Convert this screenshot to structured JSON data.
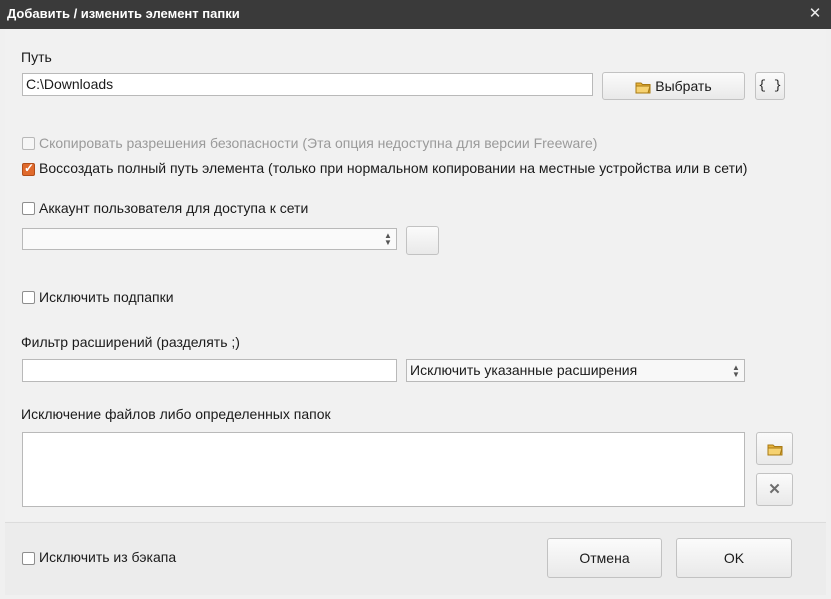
{
  "window": {
    "title": "Добавить / изменить элемент папки",
    "close_glyph": "✕"
  },
  "path": {
    "label": "Путь",
    "value": "C:\\Downloads",
    "browse_label": "Выбрать",
    "macro_label": "{ }"
  },
  "options": {
    "copy_permissions": {
      "label": "Скопировать разрешения безопасности (Эта опция недоступна для версии Freeware)",
      "checked": false,
      "disabled": true
    },
    "recreate_path": {
      "label": "Воссоздать полный путь элемента (только при нормальном копировании на местные устройства или в сети)",
      "checked": true
    },
    "network_account": {
      "label": "Аккаунт пользователя для доступа к сети",
      "checked": false
    },
    "exclude_subfolders": {
      "label": "Исключить подпапки",
      "checked": false
    }
  },
  "account": {
    "value": ""
  },
  "filter": {
    "label": "Фильтр расширений (разделять ;)",
    "value": "",
    "mode": "Исключить указанные расширения"
  },
  "exclusions": {
    "label": "Исключение файлов либо определенных папок"
  },
  "footer": {
    "exclude_backup_label": "Исключить из бэкапа",
    "cancel_label": "Отмена",
    "ok_label": "OK"
  },
  "colors": {
    "checkbox_checked": "#e06a2c",
    "folder_icon": "#e8b33a",
    "titlebar": "#3a3a3a"
  }
}
